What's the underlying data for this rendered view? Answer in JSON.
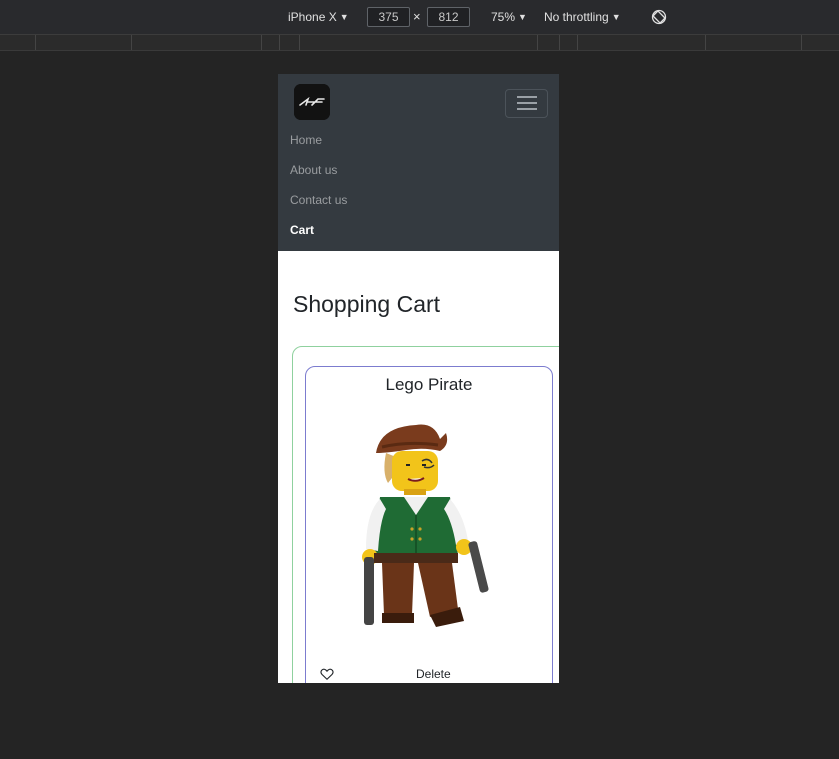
{
  "devtools": {
    "device": "iPhone X",
    "width": "375",
    "height": "812",
    "separator": "×",
    "zoom": "75%",
    "throttling": "No throttling",
    "rotate_icon": "rotate-icon",
    "caret": "▼"
  },
  "navbar": {
    "logo_icon": "brand-logo",
    "toggler_icon": "hamburger-icon",
    "links": [
      "Home",
      "About us",
      "Contact us",
      "Cart"
    ],
    "active_link": "Cart"
  },
  "page": {
    "title": "Shopping Cart"
  },
  "cart": {
    "items": [
      {
        "name": "Lego Pirate",
        "image_icon": "lego-pirate-minifigure",
        "favorite_icon": "heart-icon",
        "delete_label": "Delete"
      }
    ]
  },
  "colors": {
    "background": "#242424",
    "navbar": "#343a40",
    "outer_border": "#8fd19e",
    "card_border": "#7c7ccf"
  }
}
